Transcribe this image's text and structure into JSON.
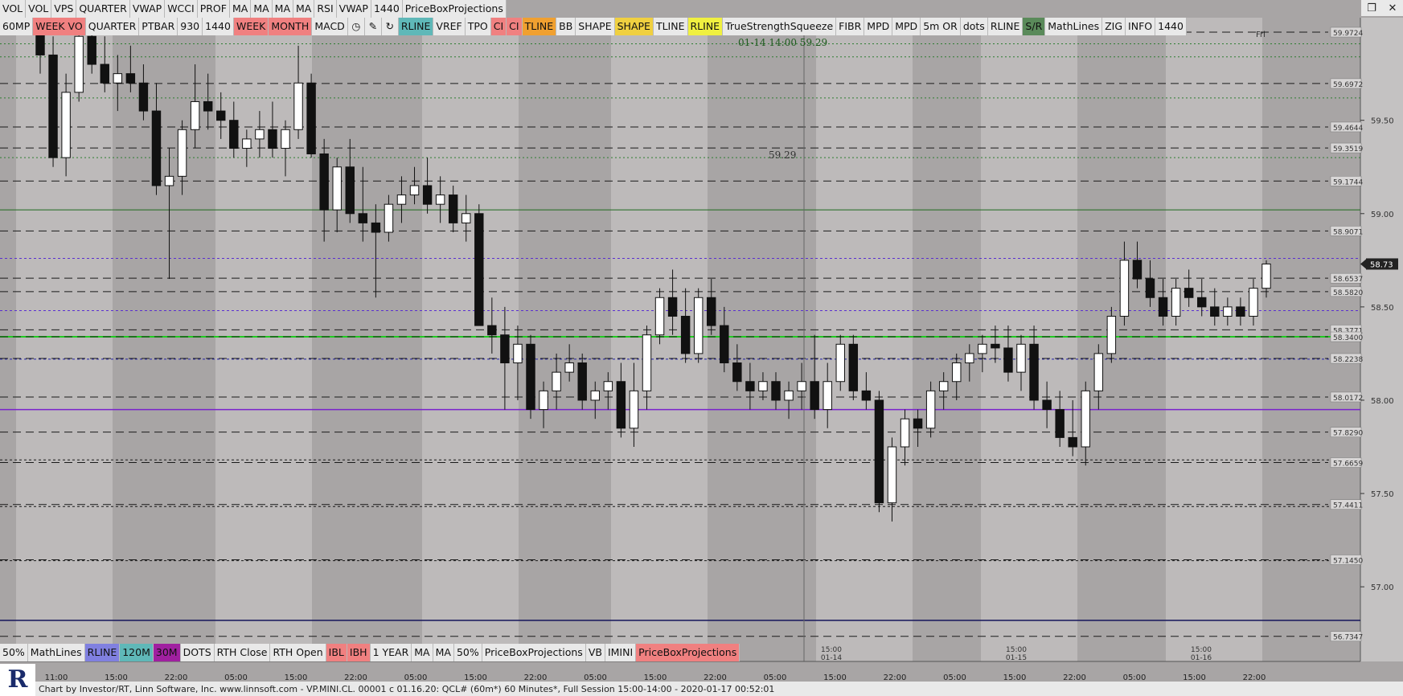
{
  "toolbar_row1": [
    "VOL",
    "VOL",
    "VPS",
    "QUARTER",
    "VWAP",
    "WCCI",
    "PROF",
    "MA",
    "MA",
    "MA",
    "MA",
    "RSI",
    "VWAP",
    "1440",
    "PriceBoxProjections"
  ],
  "toolbar_row2": [
    {
      "label": "60MP",
      "bg": "#e9e9e9"
    },
    {
      "label": "WEEK VO",
      "bg": "#f08080"
    },
    {
      "label": "QUARTER",
      "bg": "#e9e9e9"
    },
    {
      "label": "PTBAR",
      "bg": "#e9e9e9"
    },
    {
      "label": "930",
      "bg": "#e9e9e9"
    },
    {
      "label": "1440",
      "bg": "#e9e9e9"
    },
    {
      "label": "WEEK",
      "bg": "#f08080"
    },
    {
      "label": "MONTH",
      "bg": "#f08080"
    },
    {
      "label": "MACD",
      "bg": "#e9e9e9"
    },
    {
      "icon": "clock-icon",
      "glyph": "◷"
    },
    {
      "icon": "pencil-icon",
      "glyph": "✎"
    },
    {
      "icon": "refresh-icon",
      "glyph": "↻"
    },
    {
      "label": "RLINE",
      "bg": "#5fb8b8"
    },
    {
      "label": "VREF",
      "bg": "#e9e9e9"
    },
    {
      "label": "TPO",
      "bg": "#e9e9e9"
    },
    {
      "label": "CI",
      "bg": "#f08080"
    },
    {
      "label": "CI",
      "bg": "#f08080"
    },
    {
      "label": "TLINE",
      "bg": "#f0a030"
    },
    {
      "label": "BB",
      "bg": "#e9e9e9"
    },
    {
      "label": "SHAPE",
      "bg": "#e9e9e9"
    },
    {
      "label": "SHAPE",
      "bg": "#f0d040"
    },
    {
      "label": "TLINE",
      "bg": "#e9e9e9"
    },
    {
      "label": "RLINE",
      "bg": "#f0f040"
    },
    {
      "label": "TrueStrengthSqueeze",
      "bg": "#e9e9e9"
    },
    {
      "label": "FIBR",
      "bg": "#e9e9e9"
    },
    {
      "label": "MPD",
      "bg": "#e9e9e9"
    },
    {
      "label": "MPD",
      "bg": "#e9e9e9"
    },
    {
      "label": "5m OR",
      "bg": "#e9e9e9"
    },
    {
      "label": "dots",
      "bg": "#e9e9e9"
    },
    {
      "label": "RLINE",
      "bg": "#e9e9e9"
    },
    {
      "label": "S/R",
      "bg": "#5a8a5a"
    },
    {
      "label": "MathLines",
      "bg": "#e9e9e9"
    },
    {
      "label": "ZIG",
      "bg": "#e9e9e9"
    },
    {
      "label": "INFO",
      "bg": "#e9e9e9"
    },
    {
      "label": "1440",
      "bg": "#e9e9e9"
    }
  ],
  "toolbar_row3": [
    {
      "label": "50%",
      "bg": "#e9e9e9"
    },
    {
      "label": "MathLines",
      "bg": "#e9e9e9"
    },
    {
      "label": "RLINE",
      "bg": "#8080e0"
    },
    {
      "label": "120M",
      "bg": "#5fb8b8"
    },
    {
      "label": "30M",
      "bg": "#a020a0"
    },
    {
      "label": "DOTS",
      "bg": "#e9e9e9"
    },
    {
      "label": "RTH Close",
      "bg": "#e9e9e9"
    },
    {
      "label": "RTH Open",
      "bg": "#e9e9e9"
    },
    {
      "label": "IBL",
      "bg": "#f08080"
    },
    {
      "label": "IBH",
      "bg": "#f08080"
    },
    {
      "label": "1 YEAR",
      "bg": "#e9e9e9"
    },
    {
      "label": "MA",
      "bg": "#e9e9e9"
    },
    {
      "label": "MA",
      "bg": "#e9e9e9"
    },
    {
      "label": "50%",
      "bg": "#e9e9e9"
    },
    {
      "label": "PriceBoxProjections",
      "bg": "#e9e9e9"
    },
    {
      "label": "VB",
      "bg": "#e9e9e9"
    },
    {
      "label": "IMINI",
      "bg": "#e9e9e9"
    },
    {
      "label": "PriceBoxProjections",
      "bg": "#f08080"
    }
  ],
  "window_controls": [
    "❐",
    "✕"
  ],
  "status_text": "Chart by Investor/RT, Linn Software, Inc. www.linnsoft.com - VP.MINI.CL.  00001 c   01.16.20: QCL# (60m*) 60 Minutes*, Full Session 15:00-14:00 - 2020-01-17 00:52:01",
  "crosshair_label": "01-14 14:00  59.29",
  "crosshair_price": "59.29",
  "day_label": "Fri",
  "chart_data": {
    "type": "candlestick",
    "ylim": [
      56.6,
      60.05
    ],
    "y_ticks": [
      59.5,
      59.0,
      58.5,
      58.0,
      57.5,
      57.0
    ],
    "y_tick_labels": [
      "59.50",
      "59.00",
      "58.50",
      "58.00",
      "57.50",
      "57.00"
    ],
    "x_tick_labels": [
      "11:00",
      "15:00",
      "22:00",
      "05:00",
      "15:00",
      "22:00",
      "05:00",
      "15:00",
      "22:00",
      "05:00",
      "15:00",
      "22:00",
      "05:00",
      "15:00",
      "22:00",
      "05:00",
      "15:00",
      "22:00",
      "05:00",
      "15:00",
      "22:00"
    ],
    "session_labels": [
      {
        "time": "15:00",
        "date": "01-14"
      },
      {
        "time": "15:00",
        "date": "01-15"
      },
      {
        "time": "15:00",
        "date": "01-16"
      }
    ],
    "current_price": {
      "label": "58.73",
      "value": 58.73
    },
    "levels": [
      {
        "value": 59.9724,
        "label": "59.9724",
        "color": "#1a1a1a",
        "dash": "10,6"
      },
      {
        "value": 59.6972,
        "label": "59.6972",
        "color": "#1a1a1a",
        "dash": "10,6"
      },
      {
        "value": 59.4644,
        "label": "59.4644",
        "color": "#1a1a1a",
        "dash": "10,6"
      },
      {
        "value": 59.3519,
        "label": "59.3519",
        "color": "#1a1a1a",
        "dash": "10,6"
      },
      {
        "value": 59.1744,
        "label": "59.1744",
        "color": "#1a1a1a",
        "dash": "10,6"
      },
      {
        "value": 58.9071,
        "label": "58.9071",
        "color": "#1a1a1a",
        "dash": "10,6"
      },
      {
        "value": 58.6537,
        "label": "58.6537",
        "color": "#1a1a1a",
        "dash": "10,6"
      },
      {
        "value": 58.582,
        "label": "58.5820",
        "color": "#1a1a1a",
        "dash": "10,6"
      },
      {
        "value": 58.3771,
        "label": "58.3771",
        "color": "#1a1a1a",
        "dash": "10,6"
      },
      {
        "value": 58.34,
        "label": "58.3400",
        "color": "#1a1a1a",
        "dash": "10,6"
      },
      {
        "value": 58.2238,
        "label": "58.2238",
        "color": "#1a1a1a",
        "dash": "10,6"
      },
      {
        "value": 58.0172,
        "label": "58.0172",
        "color": "#1a1a1a",
        "dash": "10,6"
      },
      {
        "value": 57.829,
        "label": "57.8290",
        "color": "#1a1a1a",
        "dash": "10,6"
      },
      {
        "value": 57.6659,
        "label": "57.6659",
        "color": "#1a1a1a",
        "dash": "10,6"
      },
      {
        "value": 57.4411,
        "label": "57.4411",
        "color": "#1a1a1a",
        "dash": "10,6"
      },
      {
        "value": 57.145,
        "label": "57.1450",
        "color": "#1a1a1a",
        "dash": "10,6"
      },
      {
        "value": 56.7347,
        "label": "56.7347",
        "color": "#1a1a1a",
        "dash": "10,6"
      }
    ],
    "extra_lines": [
      {
        "value": 59.91,
        "color": "#2e7d32",
        "dash": "2,3"
      },
      {
        "value": 59.84,
        "color": "#2e7d32",
        "dash": "2,3"
      },
      {
        "value": 59.62,
        "color": "#2e7d32",
        "dash": "2,3"
      },
      {
        "value": 59.3,
        "color": "#2e7d32",
        "dash": "2,3"
      },
      {
        "value": 59.02,
        "color": "#1e6b1e",
        "dash": ""
      },
      {
        "value": 58.76,
        "color": "#5a2fd0",
        "dash": "3,3"
      },
      {
        "value": 58.48,
        "color": "#5a2fd0",
        "dash": "3,3"
      },
      {
        "value": 58.34,
        "color": "#22cc22",
        "dash": "",
        "width": 2
      },
      {
        "value": 58.22,
        "color": "#2222aa",
        "dash": "3,3"
      },
      {
        "value": 57.95,
        "color": "#7a22cc",
        "dash": "",
        "width": 1.5
      },
      {
        "value": 57.68,
        "color": "#1a1a1a",
        "dash": "3,3"
      },
      {
        "value": 57.43,
        "color": "#1a1a1a",
        "dash": "3,3"
      },
      {
        "value": 57.14,
        "color": "#1a1a1a",
        "dash": "3,3"
      },
      {
        "value": 56.82,
        "color": "#14145a",
        "dash": "",
        "width": 1.5
      }
    ],
    "candles": [
      [
        60.1,
        60.2,
        59.75,
        59.85
      ],
      [
        59.85,
        59.95,
        59.25,
        59.3
      ],
      [
        59.3,
        59.75,
        59.2,
        59.65
      ],
      [
        59.65,
        60.1,
        59.6,
        59.95
      ],
      [
        59.95,
        60.1,
        59.75,
        59.8
      ],
      [
        59.8,
        59.95,
        59.65,
        59.7
      ],
      [
        59.7,
        59.85,
        59.55,
        59.75
      ],
      [
        59.75,
        59.9,
        59.65,
        59.7
      ],
      [
        59.7,
        59.8,
        59.5,
        59.55
      ],
      [
        59.55,
        59.7,
        59.1,
        59.15
      ],
      [
        59.15,
        59.35,
        58.65,
        59.2
      ],
      [
        59.2,
        59.5,
        59.1,
        59.45
      ],
      [
        59.45,
        59.8,
        59.35,
        59.6
      ],
      [
        59.6,
        59.75,
        59.45,
        59.55
      ],
      [
        59.55,
        59.65,
        59.4,
        59.5
      ],
      [
        59.5,
        59.6,
        59.3,
        59.35
      ],
      [
        59.35,
        59.45,
        59.25,
        59.4
      ],
      [
        59.4,
        59.55,
        59.3,
        59.45
      ],
      [
        59.45,
        59.6,
        59.3,
        59.35
      ],
      [
        59.35,
        59.5,
        59.2,
        59.45
      ],
      [
        59.45,
        59.9,
        59.4,
        59.7
      ],
      [
        59.7,
        59.75,
        59.3,
        59.32
      ],
      [
        59.32,
        59.4,
        58.85,
        59.02
      ],
      [
        59.02,
        59.3,
        58.9,
        59.25
      ],
      [
        59.25,
        59.4,
        58.95,
        59.0
      ],
      [
        59.0,
        59.25,
        58.85,
        58.95
      ],
      [
        58.95,
        59.05,
        58.55,
        58.9
      ],
      [
        58.9,
        59.1,
        58.85,
        59.05
      ],
      [
        59.05,
        59.2,
        58.95,
        59.1
      ],
      [
        59.1,
        59.25,
        59.05,
        59.15
      ],
      [
        59.15,
        59.3,
        59.0,
        59.05
      ],
      [
        59.05,
        59.2,
        58.95,
        59.1
      ],
      [
        59.1,
        59.15,
        58.9,
        58.95
      ],
      [
        58.95,
        59.1,
        58.85,
        59.0
      ],
      [
        59.0,
        59.05,
        58.6,
        58.4
      ],
      [
        58.4,
        58.55,
        58.25,
        58.35
      ],
      [
        58.35,
        58.5,
        57.95,
        58.2
      ],
      [
        58.2,
        58.4,
        58.0,
        58.3
      ],
      [
        58.3,
        58.35,
        57.9,
        57.95
      ],
      [
        57.95,
        58.1,
        57.85,
        58.05
      ],
      [
        58.05,
        58.25,
        57.95,
        58.15
      ],
      [
        58.15,
        58.3,
        58.1,
        58.2
      ],
      [
        58.2,
        58.25,
        57.95,
        58.0
      ],
      [
        58.0,
        58.1,
        57.9,
        58.05
      ],
      [
        58.05,
        58.15,
        57.95,
        58.1
      ],
      [
        58.1,
        58.2,
        57.8,
        57.85
      ],
      [
        57.85,
        58.2,
        57.75,
        58.05
      ],
      [
        58.05,
        58.4,
        57.95,
        58.35
      ],
      [
        58.35,
        58.6,
        58.3,
        58.55
      ],
      [
        58.55,
        58.7,
        58.35,
        58.45
      ],
      [
        58.45,
        58.6,
        58.2,
        58.25
      ],
      [
        58.25,
        58.6,
        58.2,
        58.55
      ],
      [
        58.55,
        58.65,
        58.35,
        58.4
      ],
      [
        58.4,
        58.5,
        58.15,
        58.2
      ],
      [
        58.2,
        58.3,
        58.05,
        58.1
      ],
      [
        58.1,
        58.2,
        57.95,
        58.05
      ],
      [
        58.05,
        58.15,
        58.0,
        58.1
      ],
      [
        58.1,
        58.15,
        57.95,
        58.0
      ],
      [
        58.0,
        58.1,
        57.9,
        58.05
      ],
      [
        58.05,
        58.2,
        57.95,
        58.1
      ],
      [
        58.1,
        58.35,
        57.9,
        57.95
      ],
      [
        57.95,
        58.2,
        57.85,
        58.1
      ],
      [
        58.1,
        58.35,
        58.05,
        58.3
      ],
      [
        58.3,
        58.35,
        58.0,
        58.05
      ],
      [
        58.05,
        58.15,
        57.95,
        58.0
      ],
      [
        58.0,
        58.05,
        57.4,
        57.45
      ],
      [
        57.45,
        57.8,
        57.35,
        57.75
      ],
      [
        57.75,
        57.95,
        57.65,
        57.9
      ],
      [
        57.9,
        57.95,
        57.75,
        57.85
      ],
      [
        57.85,
        58.1,
        57.8,
        58.05
      ],
      [
        58.05,
        58.15,
        57.95,
        58.1
      ],
      [
        58.1,
        58.25,
        58.0,
        58.2
      ],
      [
        58.2,
        58.3,
        58.1,
        58.25
      ],
      [
        58.25,
        58.35,
        58.15,
        58.3
      ],
      [
        58.3,
        58.4,
        58.2,
        58.28
      ],
      [
        58.28,
        58.4,
        58.1,
        58.15
      ],
      [
        58.15,
        58.35,
        58.05,
        58.3
      ],
      [
        58.3,
        58.4,
        57.95,
        58.0
      ],
      [
        58.0,
        58.1,
        57.85,
        57.95
      ],
      [
        57.95,
        58.05,
        57.75,
        57.8
      ],
      [
        57.8,
        58.0,
        57.7,
        57.75
      ],
      [
        57.75,
        58.1,
        57.65,
        58.05
      ],
      [
        58.05,
        58.3,
        57.95,
        58.25
      ],
      [
        58.25,
        58.5,
        58.2,
        58.45
      ],
      [
        58.45,
        58.85,
        58.4,
        58.75
      ],
      [
        58.75,
        58.85,
        58.6,
        58.65
      ],
      [
        58.65,
        58.75,
        58.5,
        58.55
      ],
      [
        58.55,
        58.65,
        58.4,
        58.45
      ],
      [
        58.45,
        58.65,
        58.4,
        58.6
      ],
      [
        58.6,
        58.7,
        58.5,
        58.55
      ],
      [
        58.55,
        58.65,
        58.45,
        58.5
      ],
      [
        58.5,
        58.6,
        58.4,
        58.45
      ],
      [
        58.45,
        58.55,
        58.4,
        58.5
      ],
      [
        58.5,
        58.55,
        58.4,
        58.45
      ],
      [
        58.45,
        58.65,
        58.4,
        58.6
      ],
      [
        58.6,
        58.75,
        58.55,
        58.73
      ]
    ]
  }
}
